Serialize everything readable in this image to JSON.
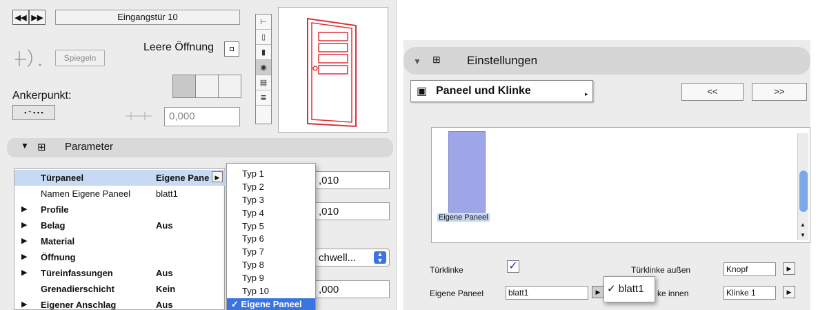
{
  "left": {
    "nav_prev": "◀◀",
    "nav_next": "▶▶",
    "title": "Eingangstür 10",
    "mirror_label": "Spiegeln",
    "empty_opening_label": "Leere Öffnung",
    "anchor_label": "Ankerpunkt:",
    "offset_value": "0,000",
    "params_header": "Parameter",
    "rows": [
      {
        "tri": "",
        "name": "Türpaneel",
        "value": "Eigene Pane",
        "bold": true,
        "selected": true
      },
      {
        "tri": "",
        "name": "Namen Eigene Paneel",
        "value": "blatt1",
        "bold": false
      },
      {
        "tri": "▶",
        "name": "Profile",
        "value": "",
        "bold": true
      },
      {
        "tri": "▶",
        "name": "Belag",
        "value": "Aus",
        "bold": true
      },
      {
        "tri": "▶",
        "name": "Material",
        "value": "",
        "bold": true
      },
      {
        "tri": "▶",
        "name": "Öffnung",
        "value": "",
        "bold": true
      },
      {
        "tri": "▶",
        "name": "Türeinfassungen",
        "value": "Aus",
        "bold": true
      },
      {
        "tri": "",
        "name": "Grenadierschicht",
        "value": "Kein",
        "bold": true
      },
      {
        "tri": "▶",
        "name": "Eigener Anschlag",
        "value": "Aus",
        "bold": true
      }
    ],
    "dropdown_items": [
      "Typ 1",
      "Typ 2",
      "Typ 3",
      "Typ 4",
      "Typ 5",
      "Typ 6",
      "Typ 7",
      "Typ 8",
      "Typ 9",
      "Typ 10"
    ],
    "dropdown_selected": "✓ Eigene Paneel",
    "side_inputs": [
      ",010",
      ",010",
      "chwell...",
      ",000"
    ]
  },
  "right": {
    "header": "Einstellungen",
    "popup_label": "Paneel und Klinke",
    "prev_btn": "<<",
    "next_btn": ">>",
    "thumb_label": "Eigene Paneel",
    "turklinke_label": "Türklinke",
    "turklinke_aussen_label": "Türklinke außen",
    "turklinke_aussen_value": "Knopf",
    "eigene_paneel_label": "Eigene Paneel",
    "eigene_paneel_value": "blatt1",
    "popup_item": "✓  blatt1",
    "innen_label": "ke innen",
    "innen_value": "Klinke 1"
  },
  "colors": {
    "accent": "#3a74e0",
    "door": "#e0303a",
    "thumb": "#9ea6e8"
  }
}
